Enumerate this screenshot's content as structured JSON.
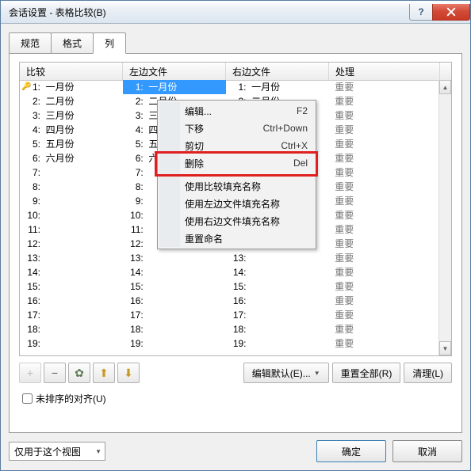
{
  "title": "会话设置 - 表格比较(B)",
  "tabs": [
    "规范",
    "格式",
    "列"
  ],
  "active_tab": 2,
  "columns": {
    "c1": "比较",
    "c2": "左边文件",
    "c3": "右边文件",
    "c4": "处理"
  },
  "months": [
    "一月份",
    "二月份",
    "三月份",
    "四月份",
    "五月份",
    "六月份"
  ],
  "important": "重要",
  "total_rows": 19,
  "context_menu": {
    "edit": "编辑...",
    "edit_sc": "F2",
    "down": "下移",
    "down_sc": "Ctrl+Down",
    "cut": "剪切",
    "cut_sc": "Ctrl+X",
    "delete": "删除",
    "delete_sc": "Del",
    "fill_compare": "使用比较填充名称",
    "fill_left": "使用左边文件填充名称",
    "fill_right": "使用右边文件填充名称",
    "reset_name": "重置命名"
  },
  "btn_edit_default": "编辑默认(E)...",
  "btn_reset_all": "重置全部(R)",
  "btn_clear": "清理(L)",
  "chk_unsorted": "未排序的对齐(U)",
  "combo_scope": "仅用于这个视图",
  "btn_ok": "确定",
  "btn_cancel": "取消",
  "minus": "−",
  "gear": "✿",
  "up": "⬆",
  "dn": "⬇",
  "plus": "+"
}
